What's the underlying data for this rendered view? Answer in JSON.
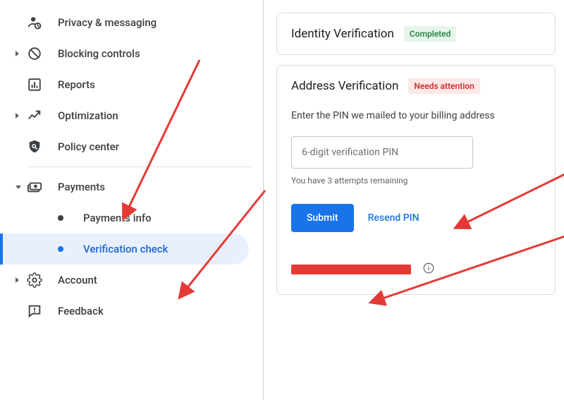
{
  "sidebar": {
    "items": [
      {
        "label": "Privacy & messaging"
      },
      {
        "label": "Blocking controls"
      },
      {
        "label": "Reports"
      },
      {
        "label": "Optimization"
      },
      {
        "label": "Policy center"
      },
      {
        "label": "Payments"
      },
      {
        "label": "Payments info"
      },
      {
        "label": "Verification check"
      },
      {
        "label": "Account"
      },
      {
        "label": "Feedback"
      }
    ]
  },
  "identity": {
    "title": "Identity Verification",
    "status": "Completed"
  },
  "address": {
    "title": "Address Verification",
    "status": "Needs attention",
    "instruction": "Enter the PIN we mailed to your billing address",
    "pin_placeholder": "6-digit verification PIN",
    "attempts_text": "You have 3 attempts remaining",
    "submit_label": "Submit",
    "resend_label": "Resend PIN"
  }
}
